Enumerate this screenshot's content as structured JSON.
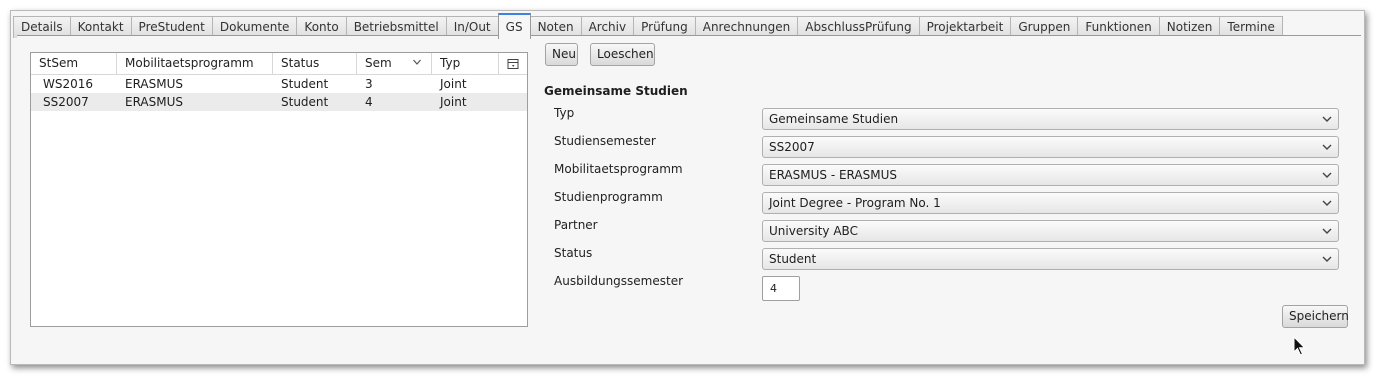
{
  "tabs": [
    "Details",
    "Kontakt",
    "PreStudent",
    "Dokumente",
    "Konto",
    "Betriebsmittel",
    "In/Out",
    "GS",
    "Noten",
    "Archiv",
    "Prüfung",
    "Anrechnungen",
    "AbschlussPrüfung",
    "Projektarbeit",
    "Gruppen",
    "Funktionen",
    "Notizen",
    "Termine"
  ],
  "active_tab": "GS",
  "list": {
    "columns": [
      "StSem",
      "Mobilitaetsprogramm",
      "Status",
      "Sem",
      "Typ"
    ],
    "rows": [
      {
        "stsem": "WS2016",
        "programm": "ERASMUS",
        "status": "Student",
        "sem": "3",
        "typ": "Joint"
      },
      {
        "stsem": "SS2007",
        "programm": "ERASMUS",
        "status": "Student",
        "sem": "4",
        "typ": "Joint"
      }
    ]
  },
  "buttons": {
    "new": "Neu",
    "delete": "Loeschen",
    "save": "Speichern"
  },
  "form": {
    "title": "Gemeinsame Studien",
    "fields": {
      "typ": {
        "label": "Typ",
        "value": "Gemeinsame Studien"
      },
      "studiensemester": {
        "label": "Studiensemester",
        "value": "SS2007"
      },
      "mobilitaetsprogramm": {
        "label": "Mobilitaetsprogramm",
        "value": "ERASMUS - ERASMUS"
      },
      "studienprogramm": {
        "label": "Studienprogramm",
        "value": "Joint Degree - Program No. 1"
      },
      "partner": {
        "label": "Partner",
        "value": "University ABC"
      },
      "status": {
        "label": "Status",
        "value": "Student"
      },
      "ausbildungssemester": {
        "label": "Ausbildungssemester",
        "value": "4"
      }
    }
  },
  "colors": {
    "active_tab_accent": "#3d80df",
    "selected_row": "#ebebeb",
    "panel_bg": "#f6f6f6"
  }
}
